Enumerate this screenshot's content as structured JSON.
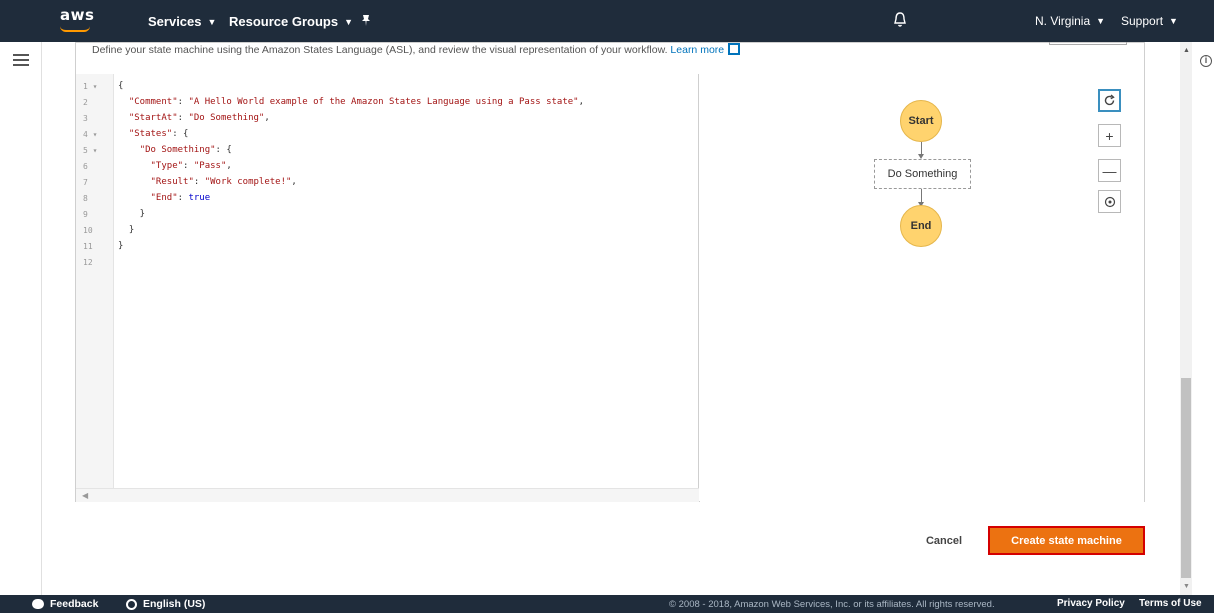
{
  "nav": {
    "logo": "aws",
    "services": "Services",
    "resource_groups": "Resource Groups",
    "region": "N. Virginia",
    "support": "Support",
    "icons": [
      "menu-icon",
      "pin-icon",
      "bell-icon",
      "info-icon"
    ]
  },
  "description": {
    "text": "Define your state machine using the Amazon States Language (ASL), and review the visual representation of your workflow.",
    "learn_more": "Learn more"
  },
  "editor": {
    "line_numbers": [
      "1 ▾",
      "2",
      "3",
      "4 ▾",
      "5 ▾",
      "6",
      "7",
      "8",
      "9",
      "10",
      "11",
      "12"
    ],
    "lines": [
      "{",
      "  \"Comment\": \"A Hello World example of the Amazon States Language using a Pass state\",",
      "  \"StartAt\": \"Do Something\",",
      "  \"States\": {",
      "    \"Do Something\": {",
      "      \"Type\": \"Pass\",",
      "      \"Result\": \"Work complete!\",",
      "      \"End\": true",
      "    }",
      "  }",
      "}",
      ""
    ]
  },
  "graph": {
    "start": "Start",
    "state": "Do Something",
    "end": "End",
    "colors": {
      "terminal_fill": "#ffd36e",
      "active_border": "#3a8fbf"
    },
    "controls": [
      "refresh-icon",
      "zoom-in-icon",
      "zoom-out-icon",
      "center-icon"
    ]
  },
  "actions": {
    "cancel": "Cancel",
    "create": "Create state machine",
    "create_color": "#ec7211"
  },
  "footer": {
    "feedback": "Feedback",
    "language": "English (US)",
    "copyright": "© 2008 - 2018, Amazon Web Services, Inc. or its affiliates. All rights reserved.",
    "privacy": "Privacy Policy",
    "terms": "Terms of Use"
  }
}
